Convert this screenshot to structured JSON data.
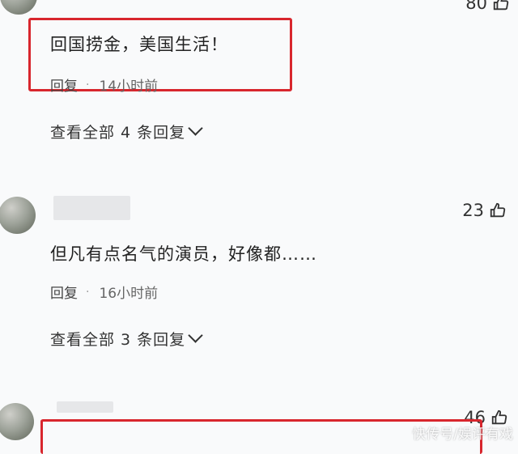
{
  "comments": [
    {
      "text": "回国捞金，美国生活！",
      "reply_label": "回复",
      "time": "14小时前",
      "likes": "80",
      "view_replies": "查看全部 4 条回复"
    },
    {
      "text": "但凡有点名气的演员，好像都……",
      "reply_label": "回复",
      "time": "16小时前",
      "likes": "23",
      "view_replies": "查看全部 3 条回复"
    },
    {
      "likes": "46"
    }
  ],
  "watermark": "快传号/娱评有戏",
  "colors": {
    "highlight": "#d8262d",
    "background": "#f9fafb"
  },
  "icons": {
    "like": "thumbs-up-icon",
    "expand": "chevron-down-icon"
  }
}
